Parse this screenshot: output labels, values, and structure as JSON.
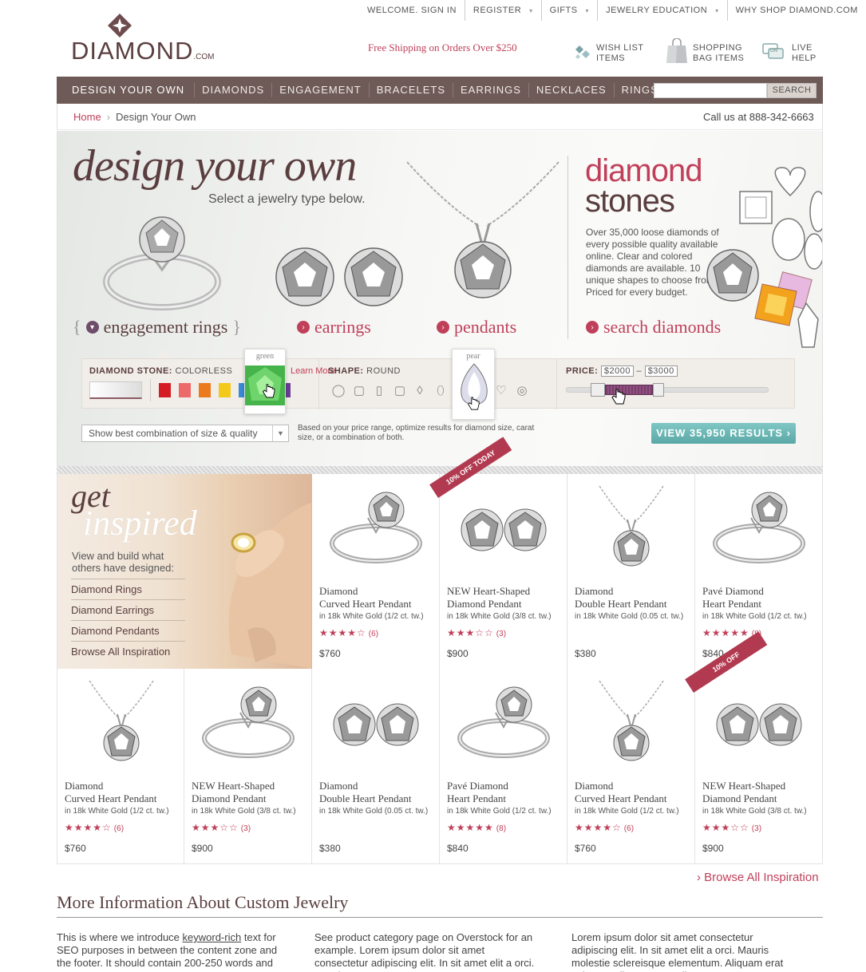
{
  "util_nav": {
    "items": [
      {
        "label": "WELCOME. SIGN IN",
        "caret": false
      },
      {
        "label": "REGISTER",
        "caret": true
      },
      {
        "label": "GIFTS",
        "caret": true
      },
      {
        "label": "JEWELRY EDUCATION",
        "caret": true
      },
      {
        "label": "WHY SHOP DIAMOND.COM",
        "caret": true
      }
    ]
  },
  "logo": {
    "name": "DIAMOND",
    "suffix": ".COM"
  },
  "header": {
    "free_shipping": "Free Shipping on Orders Over $250",
    "wishlist_l1": "WISH LIST",
    "wishlist_l2": "ITEMS",
    "bag_l1": "SHOPPING",
    "bag_l2": "BAG ITEMS",
    "help_l1": "LIVE",
    "help_l2": "HELP"
  },
  "main_nav": {
    "items": [
      "DESIGN YOUR OWN",
      "DIAMONDS",
      "ENGAGEMENT",
      "BRACELETS",
      "EARRINGS",
      "NECKLACES",
      "RINGS"
    ],
    "search_value": "",
    "search_button": "SEARCH"
  },
  "breadcrumb": {
    "home": "Home",
    "sep": "›",
    "current": "Design Your Own",
    "call": "Call us at 888-342-6663"
  },
  "hero": {
    "title": "design your own",
    "subtitle": "Select a jewelry type below.",
    "categories": [
      "engagement rings",
      "earrings",
      "pendants"
    ],
    "diamond_title_1": "diamond",
    "diamond_title_2": "stones",
    "diamond_desc": "Over 35,000 loose diamonds of every possible quality available online. Clear and colored diamonds are available. 10 unique shapes to choose from. Priced for every budget.",
    "search_link": "search diamonds"
  },
  "filters": {
    "stone_label": "DIAMOND STONE:",
    "stone_value": "COLORLESS",
    "learn_more": "Learn More",
    "color_tooltip": "green",
    "swatch_colors": [
      "#d41c24",
      "#ec6a6a",
      "#ea7a1c",
      "#f3c91c",
      "#3a8ad6",
      "#59b84f",
      "#6a3c96"
    ],
    "shape_label": "SHAPE:",
    "shape_value": "ROUND",
    "shape_tooltip": "pear",
    "shape_icons": [
      "round-icon",
      "princess-icon",
      "emerald-icon",
      "cushion-icon",
      "marquise-icon",
      "oval-icon",
      "pear-icon",
      "radiant-icon",
      "heart-icon",
      "asscher-icon"
    ],
    "price_label": "PRICE:",
    "price_min": "$2000",
    "price_dash": "–",
    "price_max": "$3000",
    "combo_value": "Show best combination of size & quality",
    "combo_note": "Based on your price range, optimize results for diamond size, carat size, or a combination of both.",
    "results_button": "VIEW 35,950 RESULTS ›"
  },
  "inspire": {
    "title_1": "get",
    "title_2": "inspired",
    "desc": "View and build what others have designed:",
    "links": [
      "Diamond Rings",
      "Diamond Earrings",
      "Diamond Pendants",
      "Browse All Inspiration"
    ]
  },
  "products": [
    {
      "t1": "Diamond",
      "t2": "Curved Heart Pendant",
      "sub": "in 18k White Gold (1/2 ct. tw.)",
      "stars": "★★★★☆",
      "count": "(6)",
      "price": "$760",
      "img": "ring",
      "ribbon": ""
    },
    {
      "t1": "NEW Heart-Shaped",
      "t2": "Diamond Pendant",
      "sub": "in 18k White Gold (3/8 ct. tw.)",
      "stars": "★★★☆☆",
      "count": "(3)",
      "price": "$900",
      "img": "earrings",
      "ribbon": "10% OFF TODAY"
    },
    {
      "t1": "Diamond",
      "t2": "Double Heart Pendant",
      "sub": "in 18k White Gold (0.05 ct. tw.)",
      "stars": "",
      "count": "",
      "price": "$380",
      "img": "pendant",
      "ribbon": ""
    },
    {
      "t1": "Pavé Diamond",
      "t2": "Heart Pendant",
      "sub": "in 18k White Gold (1/2 ct. tw.)",
      "stars": "★★★★★",
      "count": "(8)",
      "price": "$840",
      "img": "ring",
      "ribbon": ""
    },
    {
      "t1": "Diamond",
      "t2": "Curved Heart Pendant",
      "sub": "in 18k White Gold (1/2 ct. tw.)",
      "stars": "★★★★☆",
      "count": "(6)",
      "price": "$760",
      "img": "pendant",
      "ribbon": ""
    },
    {
      "t1": "NEW Heart-Shaped",
      "t2": "Diamond Pendant",
      "sub": "in 18k White Gold (3/8 ct. tw.)",
      "stars": "★★★☆☆",
      "count": "(3)",
      "price": "$900",
      "img": "ring",
      "ribbon": ""
    },
    {
      "t1": "Diamond",
      "t2": "Double Heart Pendant",
      "sub": "in 18k White Gold (0.05 ct. tw.)",
      "stars": "",
      "count": "",
      "price": "$380",
      "img": "earrings",
      "ribbon": ""
    },
    {
      "t1": "Pavé Diamond",
      "t2": "Heart Pendant",
      "sub": "in 18k White Gold (1/2 ct. tw.)",
      "stars": "★★★★★",
      "count": "(8)",
      "price": "$840",
      "img": "ring",
      "ribbon": ""
    },
    {
      "t1": "Diamond",
      "t2": "Curved Heart Pendant",
      "sub": "in 18k White Gold (1/2 ct. tw.)",
      "stars": "★★★★☆",
      "count": "(6)",
      "price": "$760",
      "img": "pendant",
      "ribbon": ""
    },
    {
      "t1": "NEW Heart-Shaped",
      "t2": "Diamond Pendant",
      "sub": "in 18k White Gold (3/8 ct. tw.)",
      "stars": "★★★☆☆",
      "count": "(3)",
      "price": "$900",
      "img": "earrings",
      "ribbon": "10% OFF"
    }
  ],
  "browse_all": "› Browse All Inspiration",
  "more_info": {
    "title": "More Information About Custom Jewelry",
    "col1_pre": "This is where we introduce ",
    "col1_link": "keyword-rich",
    "col1_post": " text for SEO purposes in between the content zone and the footer. It should contain 200-250 words and",
    "col2": "See product category page on Overstock for an example. Lorem ipsum dolor sit amet consectetur adipiscing elit. In sit amet elit a orci. Mauris",
    "col3": "Lorem ipsum dolor sit amet consectetur adipiscing elit. In sit amet elit a orci. Mauris molestie sclereisque elementum. Aliquam erat volutpat. Aliquam nec odio"
  }
}
